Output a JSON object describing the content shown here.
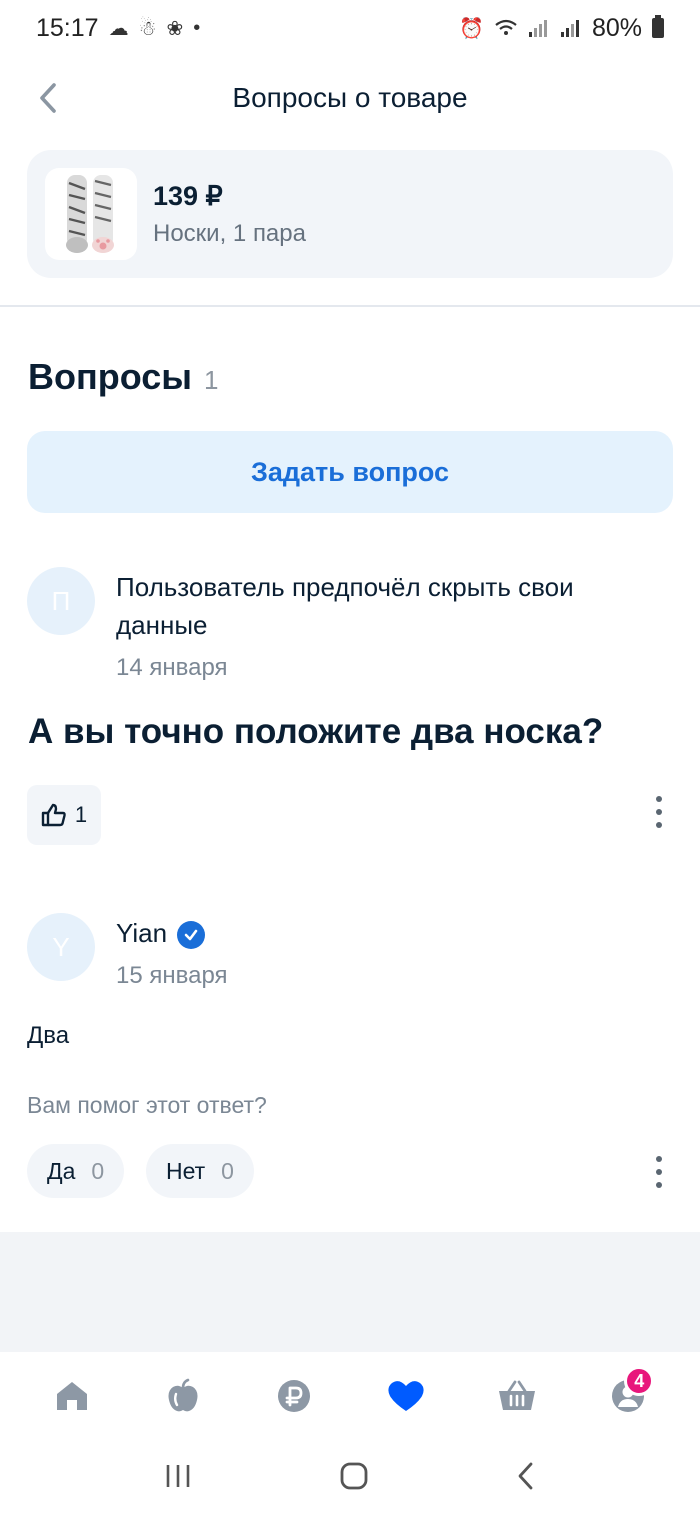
{
  "status_bar": {
    "time": "15:17",
    "battery_text": "80%",
    "left_icons": [
      "cloud-icon",
      "snowman-icon",
      "paw-icon",
      "dot-icon"
    ],
    "right_icons": [
      "alarm-icon",
      "wifi-icon",
      "signal-icon",
      "signal-icon",
      "battery-icon"
    ]
  },
  "header": {
    "title": "Вопросы о товаре",
    "back_icon": "chevron-left-icon"
  },
  "product": {
    "price": "139 ₽",
    "name": "Носки, 1 пара",
    "image": "socks-photo"
  },
  "questions": {
    "title": "Вопросы",
    "count": "1",
    "ask_button": "Задать вопрос"
  },
  "question": {
    "avatar_letter": "П",
    "author": "Пользователь предпочёл скрыть свои данные",
    "date": "14 января",
    "text": "А вы точно положите два носка?",
    "likes": "1",
    "like_icon": "thumbs-up-icon"
  },
  "answer": {
    "avatar_letter": "Y",
    "author": "Yian",
    "verified_icon": "verified-check-icon",
    "date": "15 января",
    "text": "Два",
    "helpful_prompt": "Вам помог этот ответ?",
    "yes_label": "Да",
    "yes_count": "0",
    "no_label": "Нет",
    "no_count": "0"
  },
  "bottom_nav": {
    "items": [
      {
        "icon": "home-icon"
      },
      {
        "icon": "apple-icon"
      },
      {
        "icon": "ruble-icon"
      },
      {
        "icon": "heart-icon"
      },
      {
        "icon": "basket-icon"
      },
      {
        "icon": "profile-icon",
        "badge": "4"
      }
    ]
  },
  "colors": {
    "accent": "#1a6ed8",
    "heart_active": "#005bff",
    "badge": "#e8177c",
    "text_primary": "#0b1f33",
    "text_secondary": "#7b8794"
  }
}
